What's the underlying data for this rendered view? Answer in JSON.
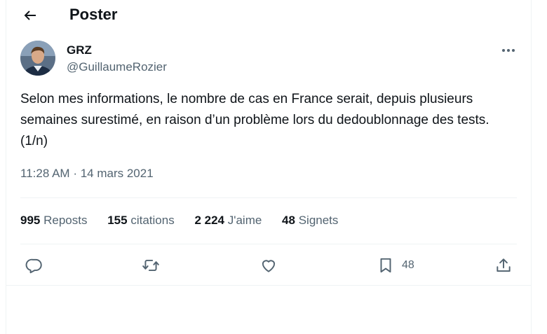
{
  "header": {
    "title": "Poster"
  },
  "tweet": {
    "author_name": "GRZ",
    "author_handle": "@GuillaumeRozier",
    "text": "Selon mes informations, le nombre de cas en France serait, depuis plusieurs semaines surestimé, en raison d’un problème lors du dedoublonnage des tests. (1/n)",
    "time": "11:28 AM",
    "date": "14 mars 2021"
  },
  "stats": {
    "reposts": {
      "count": "995",
      "label": "Reposts"
    },
    "quotes": {
      "count": "155",
      "label": "citations"
    },
    "likes": {
      "count": "2 224",
      "label": "J'aime"
    },
    "bookmarks": {
      "count": "48",
      "label": "Signets"
    }
  },
  "actions": {
    "bookmark_count": "48"
  },
  "colors": {
    "text": "#0f1419",
    "secondary": "#536471",
    "divider": "#eff3f4"
  },
  "icons": [
    "back-arrow-icon",
    "more-icon",
    "reply-icon",
    "retweet-icon",
    "like-icon",
    "bookmark-icon",
    "share-icon"
  ]
}
